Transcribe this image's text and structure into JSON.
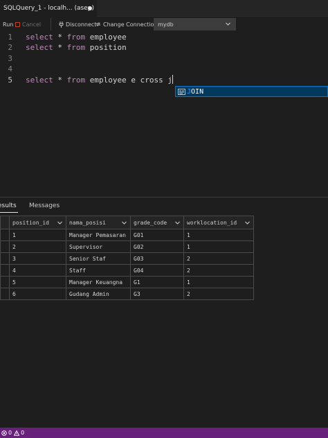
{
  "tab": {
    "title": "SQLQuery_1 - localh... (asep)"
  },
  "toolbar": {
    "run_label": "Run",
    "cancel_label": "Cancel",
    "disconnect_label": "Disconnect",
    "change_connection_label": "Change Connection",
    "database_value": "mydb"
  },
  "editor": {
    "line_numbers": [
      "1",
      "2",
      "3",
      "4",
      "5"
    ],
    "lines": [
      {
        "kw1": "select",
        "op": " * ",
        "kw2": "from",
        "rest": " employee"
      },
      {
        "kw1": "select",
        "op": " * ",
        "kw2": "from",
        "rest": " position"
      },
      {},
      {},
      {
        "kw1": "select",
        "op": " * ",
        "kw2": "from",
        "rest": " employee e cross j"
      }
    ],
    "suggestion": {
      "match": "J",
      "rest": "OIN"
    }
  },
  "results_panel": {
    "tab_results": "esults",
    "tab_messages": "Messages",
    "columns": [
      "position_id",
      "nama_posisi",
      "grade_code",
      "worklocation_id"
    ],
    "rows": [
      [
        "1",
        "Manager Pemasaran",
        "G01",
        "1"
      ],
      [
        "2",
        "Supervisor",
        "G02",
        "1"
      ],
      [
        "3",
        "Senior Staf",
        "G03",
        "2"
      ],
      [
        "4",
        "Staff",
        "G04",
        "2"
      ],
      [
        "5",
        "Manager Keuangna",
        "G1",
        "1"
      ],
      [
        "6",
        "Gudang Admin",
        "G3",
        "2"
      ]
    ]
  },
  "statusbar": {
    "errors": "0",
    "warnings": "0"
  },
  "colors": {
    "statusbar": "#68217a",
    "keyword": "#c586c0",
    "suggest_bg": "#04395e",
    "suggest_match": "#3794ff"
  },
  "icons": [
    "run-icon",
    "cancel-icon",
    "disconnect-icon",
    "change-connection-icon",
    "chevron-down-icon",
    "keyword-icon",
    "error-icon",
    "warning-icon"
  ]
}
